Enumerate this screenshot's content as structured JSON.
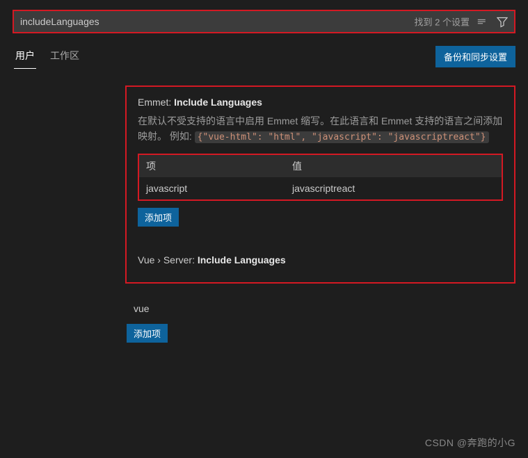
{
  "search": {
    "value": "includeLanguages",
    "result_text": "找到 2 个设置"
  },
  "tabs": {
    "user": "用户",
    "workspace": "工作区"
  },
  "sync_button": "备份和同步设置",
  "emmet": {
    "title_prefix": "Emmet: ",
    "title_name": "Include Languages",
    "desc_before": "在默认不受支持的语言中启用 Emmet 缩写。在此语言和 Emmet 支持的语言之间添加映射。 例如: ",
    "desc_code": "{\"vue-html\": \"html\", \"javascript\": \"javascriptreact\"}",
    "col_key": "项",
    "col_val": "值",
    "rows": [
      {
        "key": "javascript",
        "val": "javascriptreact"
      }
    ],
    "add_label": "添加项"
  },
  "vueServer": {
    "title_prefix": "Vue › Server: ",
    "title_name": "Include Languages",
    "items": [
      "vue"
    ],
    "add_label": "添加项"
  },
  "watermark": "CSDN @奔跑的小G",
  "icons": {
    "clear": "clear-icon",
    "filter": "filter-icon"
  }
}
